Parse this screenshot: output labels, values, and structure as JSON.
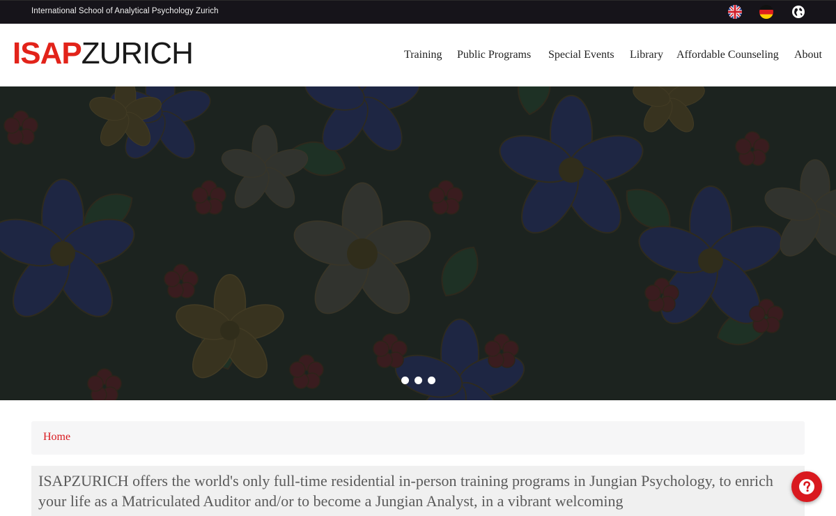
{
  "topbar": {
    "title": "International School of Analytical Psychology Zurich",
    "languages": [
      {
        "name": "uk-flag-icon",
        "label": "English"
      },
      {
        "name": "germany-flag-icon",
        "label": "Deutsch"
      },
      {
        "name": "globe-icon",
        "label": "Other languages"
      }
    ]
  },
  "logo": {
    "part1": "ISAP",
    "part2": "ZURICH"
  },
  "nav": {
    "items": [
      {
        "label": "Training"
      },
      {
        "label": "Public Programs"
      },
      {
        "label": "Special Events"
      },
      {
        "label": "Library"
      },
      {
        "label": "Affordable Counseling"
      },
      {
        "label": "About"
      }
    ]
  },
  "carousel": {
    "slide_count": 3,
    "active_index": 0,
    "indicator_names": [
      "carousel-dot-1",
      "carousel-dot-2",
      "carousel-dot-3"
    ]
  },
  "breadcrumb": {
    "home": "Home"
  },
  "intro": {
    "text": "ISAPZURICH offers the world's only full-time residential in-person training programs in Jungian Psychology, to enrich your life as a Matriculated Auditor and/or to become a Jungian Analyst, in a vibrant welcoming"
  },
  "help": {
    "icon": "question-icon"
  },
  "colors": {
    "brand_red": "#e2231a",
    "link_red": "#d9191f",
    "topbar_bg": "#16141a",
    "hero_overlay": "#23241f"
  }
}
